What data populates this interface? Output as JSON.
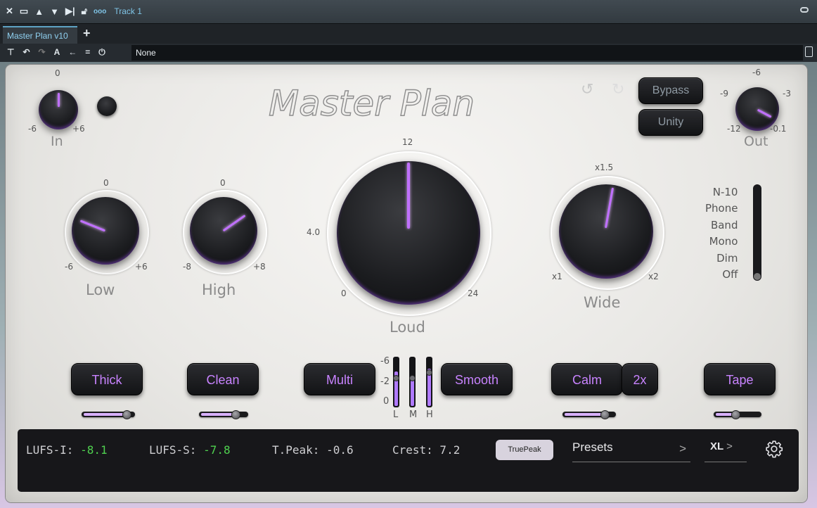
{
  "titlebar": {
    "track_name": "Track 1"
  },
  "tabs": [
    {
      "label": "Master Plan v10"
    }
  ],
  "toolbar": {
    "preset_value": "None"
  },
  "plugin": {
    "title": "Master Plan",
    "buttons": {
      "bypass": "Bypass",
      "unity": "Unity",
      "thick": "Thick",
      "clean": "Clean",
      "multi": "Multi",
      "smooth": "Smooth",
      "calm": "Calm",
      "twox": "2x",
      "tape": "Tape"
    },
    "knobs": {
      "in": {
        "label": "In",
        "top": "0",
        "min": "-6",
        "max": "+6"
      },
      "out": {
        "label": "Out",
        "top": "-6",
        "left": "-9",
        "right": "-3",
        "min": "-12",
        "max": "-0.1"
      },
      "low": {
        "label": "Low",
        "top": "0",
        "min": "-6",
        "max": "+6"
      },
      "high": {
        "label": "High",
        "top": "0",
        "min": "-8",
        "max": "+8"
      },
      "loud": {
        "label": "Loud",
        "top": "12",
        "left": "4.0",
        "min": "0",
        "max": "24"
      },
      "wide": {
        "label": "Wide",
        "top": "x1.5",
        "min": "x1",
        "max": "x2"
      }
    },
    "modes": [
      "N-10",
      "Phone",
      "Band",
      "Mono",
      "Dim",
      "Off"
    ],
    "meter_scale": [
      "-6",
      "-2",
      "0"
    ],
    "meter_labels": [
      "L",
      "M",
      "H"
    ],
    "meter_levels": [
      0.72,
      0.62,
      0.78
    ],
    "slider_levels": {
      "thick": 0.9,
      "clean": 0.8,
      "calm": 0.85,
      "tape": 0.45
    }
  },
  "footer": {
    "lufs_i_label": "LUFS-I:",
    "lufs_i_value": "-8.1",
    "lufs_s_label": "LUFS-S:",
    "lufs_s_value": "-7.8",
    "tpeak": "T.Peak: -0.6",
    "crest": "Crest: 7.2",
    "truepeak_button": "TruePeak",
    "presets_label": "Presets",
    "presets_chevron": ">",
    "size_label": "XL",
    "size_chevron": ">"
  }
}
